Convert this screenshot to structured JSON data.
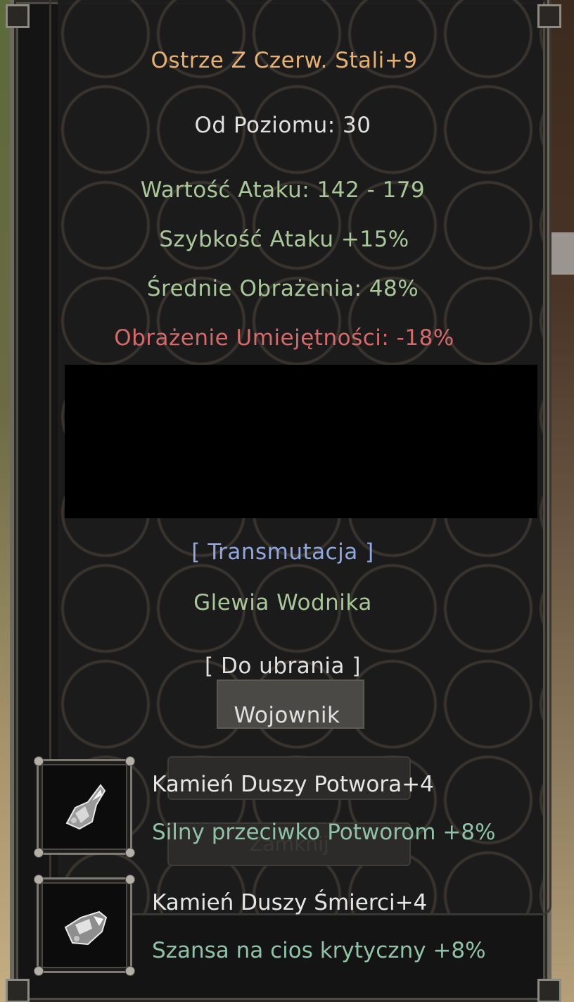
{
  "item": {
    "name": "Ostrze Z Czerw. Stali+9",
    "level_req": "Od Poziomu: 30",
    "attack_value": "Wartość Ataku: 142 - 179",
    "attack_speed": "Szybkość Ataku +15%",
    "avg_damage": "Średnie Obrażenia: 48%",
    "skill_damage": "Obrażenie Umiejętności: -18%"
  },
  "transmutation": {
    "header": "[ Transmutacja ]",
    "value": "Glewia Wodnika"
  },
  "wearable": {
    "header": "[ Do ubrania ]",
    "value": "Wojownik"
  },
  "background_ui": {
    "close_button_label": "Zamknij"
  },
  "sockets": [
    {
      "icon": "soul-stone-monster-icon",
      "name": "Kamień Duszy Potwora+4",
      "bonus": "Silny przeciwko Potworom +8%"
    },
    {
      "icon": "soul-stone-death-icon",
      "name": "Kamień Duszy Śmierci+4",
      "bonus": "Szansa na cios krytyczny +8%"
    }
  ],
  "colors": {
    "name": "#e8b070",
    "stat": "#a8c898",
    "negative": "#d66a6a",
    "section": "#8fa8e0",
    "socket_bonus": "#8fc3a8"
  }
}
